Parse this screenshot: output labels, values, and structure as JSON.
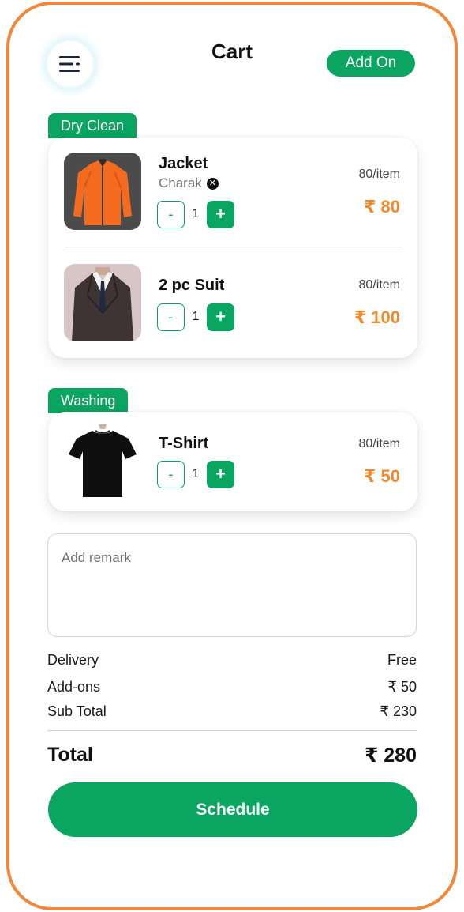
{
  "header": {
    "title": "Cart",
    "add_on_label": "Add On"
  },
  "sections": [
    {
      "tag": "Dry Clean",
      "items": [
        {
          "name": "Jacket",
          "vendor": "Charak",
          "rate": "80/item",
          "price": "₹ 80",
          "quantity": "1",
          "image": "orange-jacket"
        },
        {
          "name": "2 pc Suit",
          "rate": "80/item",
          "price": "₹ 100",
          "quantity": "1",
          "image": "dark-suit"
        }
      ]
    },
    {
      "tag": "Washing",
      "items": [
        {
          "name": "T-Shirt",
          "rate": "80/item",
          "price": "₹ 50",
          "quantity": "1",
          "image": "black-tshirt"
        }
      ]
    }
  ],
  "stepper": {
    "minus": "-",
    "plus": "+"
  },
  "remark": {
    "placeholder": "Add remark"
  },
  "summary": {
    "delivery_label": "Delivery",
    "delivery_value": "Free",
    "addons_label": "Add-ons",
    "addons_value": "₹ 50",
    "subtotal_label": "Sub Total",
    "subtotal_value": "₹ 230",
    "total_label": "Total",
    "total_value": "₹ 280"
  },
  "schedule_label": "Schedule",
  "colors": {
    "accent": "#0aa561",
    "price": "#ee8a2c",
    "frame": "#f0873a"
  }
}
